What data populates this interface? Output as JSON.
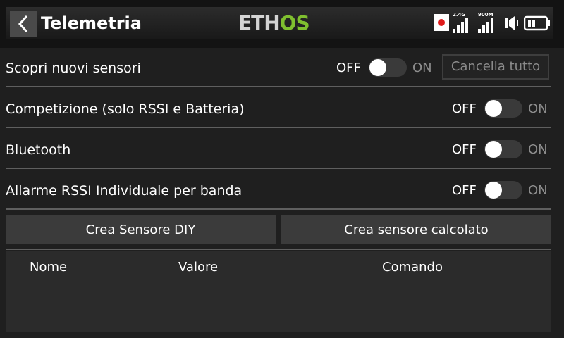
{
  "header": {
    "title": "Telemetria",
    "logo_part1": "ETH",
    "logo_part2": "OS",
    "status": {
      "band1_label": "2.4G",
      "band2_label": "900M",
      "icons": [
        "record-icon",
        "signal-2.4g-icon",
        "signal-900m-icon",
        "volume-mute-icon",
        "battery-icon"
      ]
    }
  },
  "settings": [
    {
      "label": "Scopri nuovi sensori",
      "off": "OFF",
      "on": "ON",
      "state": "off"
    },
    {
      "label": "Competizione (solo RSSI e Batteria)",
      "off": "OFF",
      "on": "ON",
      "state": "off"
    },
    {
      "label": "Bluetooth",
      "off": "OFF",
      "on": "ON",
      "state": "off"
    },
    {
      "label": "Allarme RSSI Individuale per banda",
      "off": "OFF",
      "on": "ON",
      "state": "off"
    }
  ],
  "actions": {
    "clear_all": "Cancella tutto",
    "create_diy": "Crea Sensore DIY",
    "create_calculated": "Crea sensore calcolato"
  },
  "table": {
    "columns": [
      "Nome",
      "Valore",
      "Comando"
    ],
    "rows": []
  },
  "colors": {
    "background": "#1f1f1f",
    "logo_accent": "#7fbf2f",
    "record_dot": "#e01b1b"
  }
}
